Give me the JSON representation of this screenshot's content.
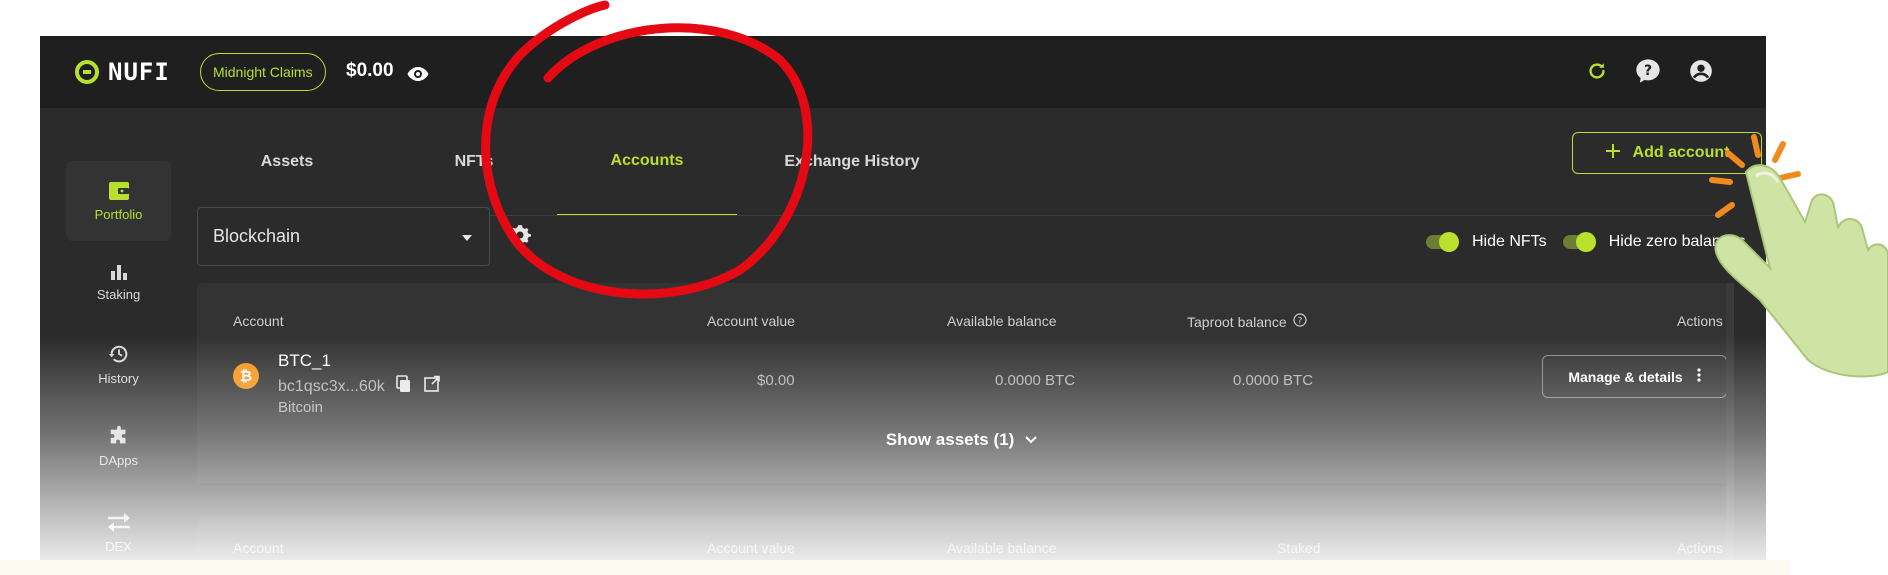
{
  "colors": {
    "accent": "#b9e02c",
    "topbar": "#1f1f1f",
    "body": "#2b2b2b",
    "card": "#333333",
    "bitcoin": "#f7931a",
    "annotation_circle": "#e50914"
  },
  "header": {
    "logo_text": "NUFI",
    "claims_label": "Midnight Claims",
    "balance": "$0.00",
    "icons": [
      "eye-icon",
      "refresh-icon",
      "help-icon",
      "account-circle-icon"
    ]
  },
  "sidebar": {
    "items": [
      {
        "label": "Portfolio",
        "icon": "wallet-icon",
        "active": true
      },
      {
        "label": "Staking",
        "icon": "bar-chart-icon",
        "active": false
      },
      {
        "label": "History",
        "icon": "history-icon",
        "active": false
      },
      {
        "label": "DApps",
        "icon": "puzzle-icon",
        "active": false
      },
      {
        "label": "DEX",
        "icon": "swap-icon",
        "active": false
      }
    ]
  },
  "tabs": [
    {
      "label": "Assets",
      "active": false
    },
    {
      "label": "NFTs",
      "active": false
    },
    {
      "label": "Accounts",
      "active": true
    },
    {
      "label": "Exchange History",
      "active": false
    }
  ],
  "toolbar": {
    "add_account_label": "Add account",
    "blockchain_select": "Blockchain",
    "hide_nfts_label": "Hide NFTs",
    "hide_zero_label": "Hide zero balances",
    "hide_nfts_on": true,
    "hide_zero_on": true
  },
  "accounts": [
    {
      "headers": {
        "account": "Account",
        "value": "Account value",
        "available": "Available balance",
        "extra": "Taproot balance",
        "actions": "Actions"
      },
      "name": "BTC_1",
      "address": "bc1qsc3x...60k",
      "chain": "Bitcoin",
      "value": "$0.00",
      "available": "0.0000 BTC",
      "extra": "0.0000 BTC",
      "manage_label": "Manage & details",
      "show_assets_label": "Show assets (1)"
    },
    {
      "headers": {
        "account": "Account",
        "value": "Account value",
        "available": "Available balance",
        "extra": "Staked",
        "actions": "Actions"
      }
    }
  ]
}
